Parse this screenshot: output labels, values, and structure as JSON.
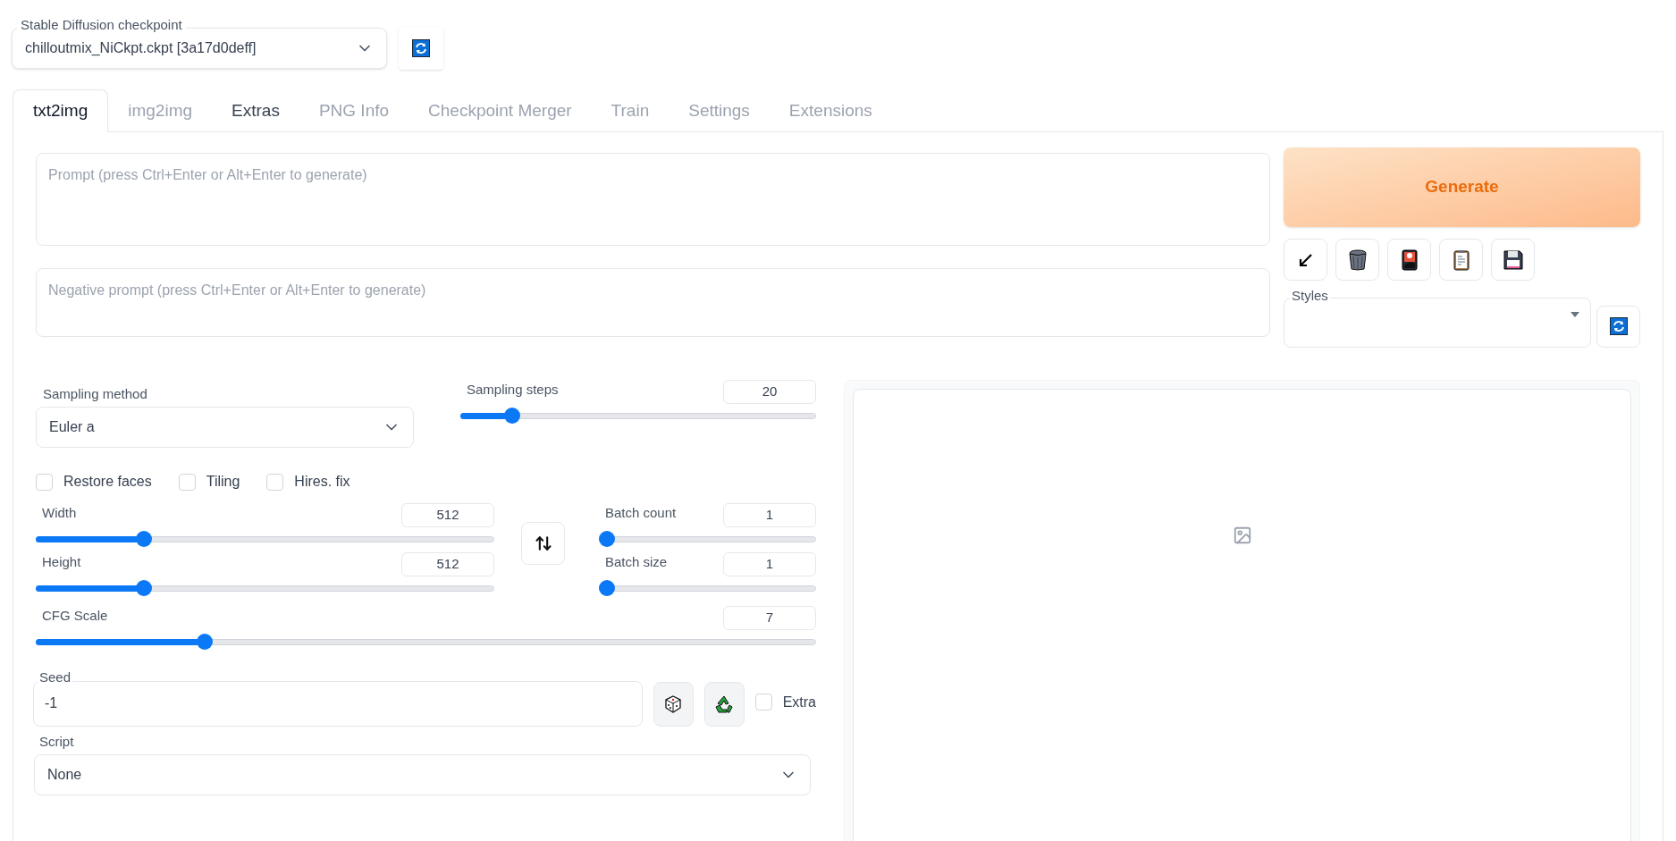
{
  "checkpoint": {
    "label": "Stable Diffusion checkpoint",
    "value": "chilloutmix_NiCkpt.ckpt [3a17d0deff]"
  },
  "tabs": [
    {
      "label": "txt2img",
      "selected": true,
      "hovered": false
    },
    {
      "label": "img2img",
      "selected": false,
      "hovered": false
    },
    {
      "label": "Extras",
      "selected": false,
      "hovered": true
    },
    {
      "label": "PNG Info",
      "selected": false,
      "hovered": false
    },
    {
      "label": "Checkpoint Merger",
      "selected": false,
      "hovered": false
    },
    {
      "label": "Train",
      "selected": false,
      "hovered": false
    },
    {
      "label": "Settings",
      "selected": false,
      "hovered": false
    },
    {
      "label": "Extensions",
      "selected": false,
      "hovered": false
    }
  ],
  "prompt": {
    "placeholder": "Prompt (press Ctrl+Enter or Alt+Enter to generate)"
  },
  "negative_prompt": {
    "placeholder": "Negative prompt (press Ctrl+Enter or Alt+Enter to generate)"
  },
  "generate_button": "Generate",
  "styles": {
    "label": "Styles"
  },
  "sampling_method": {
    "label": "Sampling method",
    "value": "Euler a"
  },
  "sampling_steps": {
    "label": "Sampling steps",
    "value": "20",
    "level": 0.13
  },
  "checkboxes": [
    {
      "label": "Restore faces",
      "checked": false
    },
    {
      "label": "Tiling",
      "checked": false
    },
    {
      "label": "Hires. fix",
      "checked": false
    }
  ],
  "width": {
    "label": "Width",
    "value": "512",
    "level": 0.226
  },
  "height": {
    "label": "Height",
    "value": "512",
    "level": 0.226
  },
  "batch_count": {
    "label": "Batch count",
    "value": "1",
    "level": 0
  },
  "batch_size": {
    "label": "Batch size",
    "value": "1",
    "level": 0
  },
  "cfg_scale": {
    "label": "CFG Scale",
    "value": "7",
    "level": 0.21
  },
  "seed": {
    "label": "Seed",
    "value": "-1",
    "extra": {
      "label": "Extra",
      "checked": false
    }
  },
  "script": {
    "label": "Script",
    "value": "None"
  }
}
